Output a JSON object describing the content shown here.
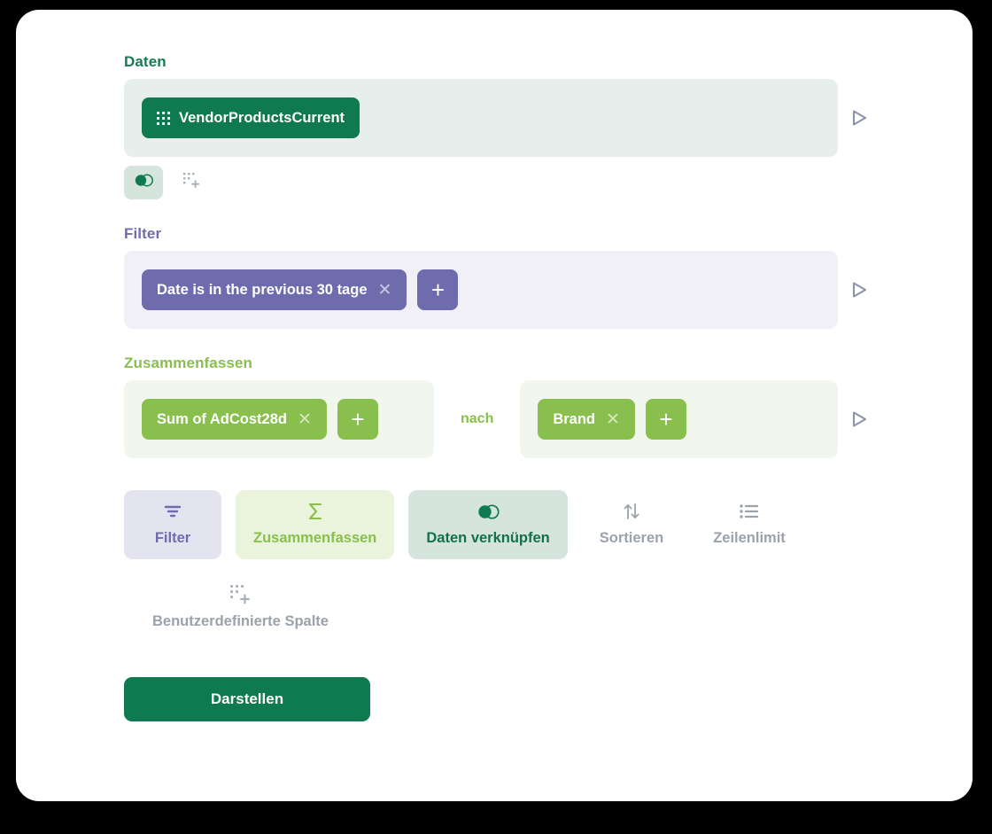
{
  "sections": {
    "data": {
      "heading": "Daten",
      "source_chip": {
        "label": "VendorProductsCurrent",
        "icon": "table-grid-icon"
      },
      "mini_buttons": [
        {
          "icon": "join-venn-icon",
          "active": true
        },
        {
          "icon": "custom-column-icon",
          "active": false
        }
      ],
      "run_icon": "play-triangle-icon"
    },
    "filter": {
      "heading": "Filter",
      "chips": [
        {
          "label": "Date is in the previous 30 tage",
          "remove_icon": "close-x-icon"
        }
      ],
      "add_label": "+",
      "run_icon": "play-triangle-icon"
    },
    "summarize": {
      "heading": "Zusammenfassen",
      "metric_chips": [
        {
          "label": "Sum of AdCost28d",
          "remove_icon": "close-x-icon"
        }
      ],
      "metric_add_label": "+",
      "connector": "nach",
      "dimension_chips": [
        {
          "label": "Brand",
          "remove_icon": "close-x-icon"
        }
      ],
      "dimension_add_label": "+",
      "run_icon": "play-triangle-icon"
    }
  },
  "action_tiles": [
    {
      "label": "Filter",
      "icon": "filter-funnel-icon",
      "state": "filter"
    },
    {
      "label": "Zusammenfassen",
      "icon": "sigma-sum-icon",
      "state": "summarize"
    },
    {
      "label": "Daten verknüpfen",
      "icon": "join-venn-icon",
      "state": "join"
    },
    {
      "label": "Sortieren",
      "icon": "sort-arrows-icon",
      "state": "plain"
    },
    {
      "label": "Zeilenlimit",
      "icon": "row-limit-list-icon",
      "state": "plain"
    }
  ],
  "custom_column": {
    "label": "Benutzerdefinierte Spalte",
    "icon": "custom-column-icon"
  },
  "primary_action": {
    "label": "Darstellen"
  },
  "colors": {
    "brand_green": "#0f7a4f",
    "accent_green": "#88bf4d",
    "accent_purple": "#6f6cae",
    "muted_gray": "#9aa2ab",
    "panel_data_bg": "#e7efec",
    "panel_filter_bg": "#f0f0f6",
    "panel_summarize_bg": "#f2f7ed",
    "join_tile_bg": "#d5e5de"
  }
}
